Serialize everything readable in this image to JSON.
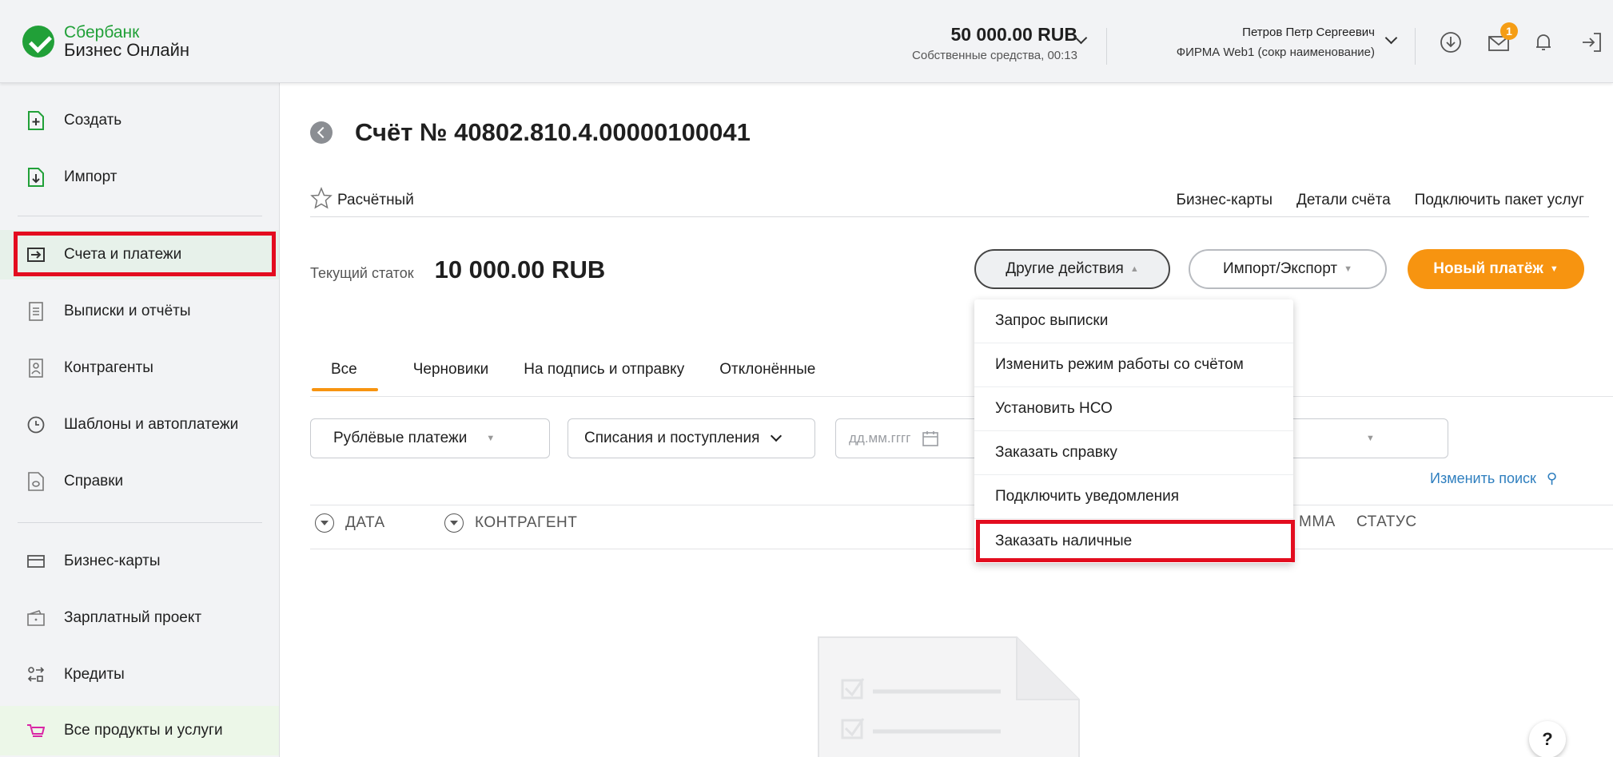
{
  "header": {
    "logo_top": "Сбербанк",
    "logo_bottom": "Бизнес Онлайн",
    "balance_amount": "50 000.00 RUB",
    "balance_sub": "Собственные средства, 00:13",
    "user_name": "Петров Петр Сергеевич",
    "user_org": "ФИРМА Web1 (сокр наименование)",
    "notification_count": "1"
  },
  "sidebar": {
    "items": [
      {
        "label": "Создать",
        "icon": "plus-doc-icon"
      },
      {
        "label": "Импорт",
        "icon": "import-doc-icon"
      },
      {
        "label": "Счета и платежи",
        "icon": "arrow-right-icon"
      },
      {
        "label": "Выписки и отчёты",
        "icon": "list-doc-icon"
      },
      {
        "label": "Контрагенты",
        "icon": "person-card-icon"
      },
      {
        "label": "Шаблоны и автоплатежи",
        "icon": "clock-icon"
      },
      {
        "label": "Справки",
        "icon": "certificate-icon"
      },
      {
        "label": "Бизнес-карты",
        "icon": "card-icon"
      },
      {
        "label": "Зарплатный проект",
        "icon": "wallet-icon"
      },
      {
        "label": "Кредиты",
        "icon": "exchange-icon"
      },
      {
        "label": "Все продукты и услуги",
        "icon": "cart-icon"
      }
    ]
  },
  "page": {
    "title": "Счёт № 40802.810.4.00000100041",
    "account_type": "Расчётный",
    "links": [
      "Бизнес-карты",
      "Детали счёта",
      "Подключить пакет услуг"
    ],
    "balance_label": "Текущий статок",
    "balance_value": "10 000.00 RUB"
  },
  "actions": {
    "other": "Другие действия",
    "import_export": "Импорт/Экспорт",
    "new_payment": "Новый платёж"
  },
  "tabs": [
    "Все",
    "Черновики",
    "На подпись и отправку",
    "Отклонённые"
  ],
  "filters": {
    "payment_type": "Рублёвые платежи",
    "direction": "Списания и поступления",
    "date_placeholder": "дд.мм.гггг",
    "change_search": "Изменить поиск"
  },
  "columns": {
    "date": "ДАТА",
    "counterparty": "КОНТРАГЕНТ",
    "sum_partial": "ММА",
    "status": "СТАТУС"
  },
  "dropdown": {
    "items": [
      "Запрос выписки",
      "Изменить режим работы со счётом",
      "Установить НСО",
      "Заказать справку",
      "Подключить уведомления",
      "Заказать наличные"
    ]
  },
  "help_label": "?",
  "colors": {
    "brand_green": "#21a038",
    "accent_orange": "#f79410",
    "highlight_red": "#e30d1f",
    "link_blue": "#2f7fbf"
  }
}
